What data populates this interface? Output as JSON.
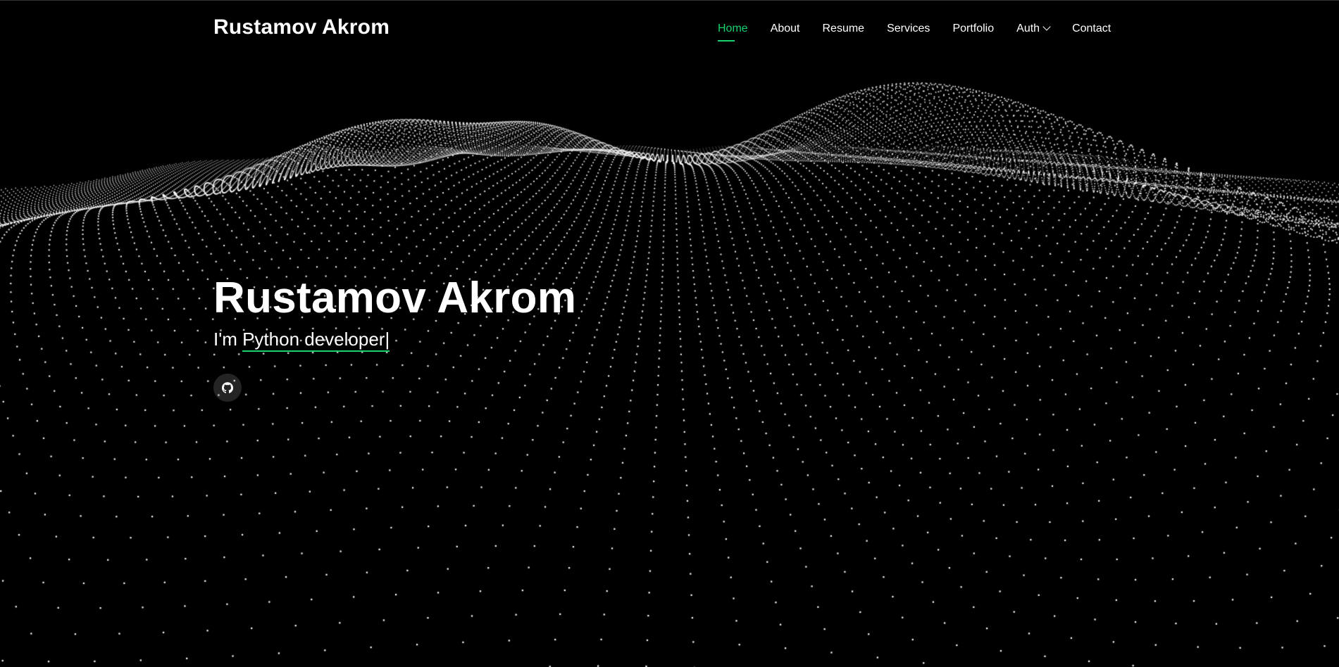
{
  "header": {
    "logo": "Rustamov Akrom"
  },
  "nav": {
    "items": [
      {
        "label": "Home",
        "active": true
      },
      {
        "label": "About"
      },
      {
        "label": "Resume"
      },
      {
        "label": "Services"
      },
      {
        "label": "Portfolio"
      },
      {
        "label": "Auth",
        "has_dropdown": true
      },
      {
        "label": "Contact"
      }
    ]
  },
  "hero": {
    "title": "Rustamov Akrom",
    "subtitle_prefix": "I'm ",
    "typed_text": "Python developer",
    "cursor": "|",
    "social": [
      {
        "icon": "github-icon"
      }
    ]
  },
  "colors": {
    "background": "#000000",
    "accent": "#18d26e",
    "text": "#ffffff"
  }
}
